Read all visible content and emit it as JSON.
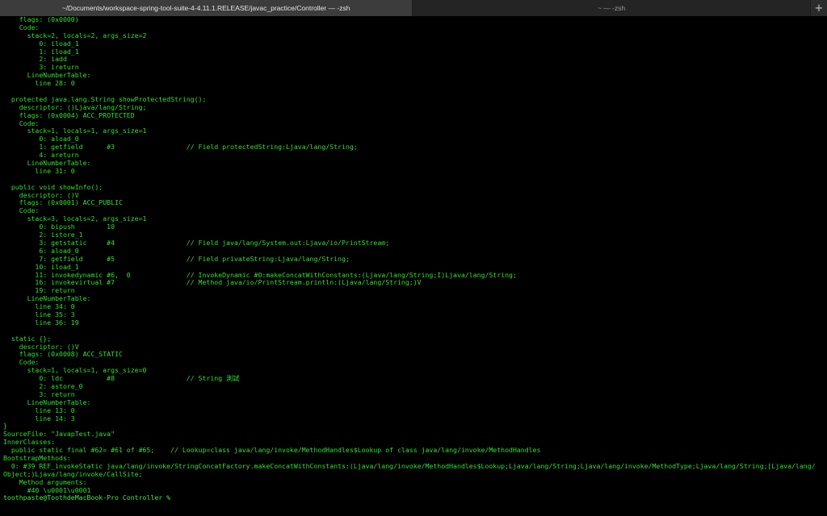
{
  "window": {
    "tabs": [
      {
        "label": "~/Documents/workspace-spring-tool-suite-4-4.11.1.RELEASE/javac_practice/Controller — -zsh",
        "active": true
      },
      {
        "label": "~ — -zsh",
        "active": false
      }
    ],
    "new_tab_icon": "plus-icon"
  },
  "terminal": {
    "text_color": "#2fe02f",
    "background": "#000000",
    "lines": [
      "    flags: (0x0000)",
      "    Code:",
      "      stack=2, locals=2, args_size=2",
      "         0: iload_1",
      "         1: iload_1",
      "         2: iadd",
      "         3: ireturn",
      "      LineNumberTable:",
      "        line 28: 0",
      "",
      "  protected java.lang.String showProtectedString();",
      "    descriptor: ()Ljava/lang/String;",
      "    flags: (0x0004) ACC_PROTECTED",
      "    Code:",
      "      stack=1, locals=1, args_size=1",
      "         0: aload_0",
      "         1: getfield      #3                  // Field protectedString:Ljava/lang/String;",
      "         4: areturn",
      "      LineNumberTable:",
      "        line 31: 0",
      "",
      "  public void showInfo();",
      "    descriptor: ()V",
      "    flags: (0x0001) ACC_PUBLIC",
      "    Code:",
      "      stack=3, locals=2, args_size=1",
      "         0: bipush        10",
      "         2: istore_1",
      "         3: getstatic     #4                  // Field java/lang/System.out:Ljava/io/PrintStream;",
      "         6: aload_0",
      "         7: getfield      #5                  // Field privateString:Ljava/lang/String;",
      "        10: iload_1",
      "        11: invokedynamic #6,  0              // InvokeDynamic #0:makeConcatWithConstants:(Ljava/lang/String;I)Ljava/lang/String;",
      "        16: invokevirtual #7                  // Method java/io/PrintStream.println:(Ljava/lang/String;)V",
      "        19: return",
      "      LineNumberTable:",
      "        line 34: 0",
      "        line 35: 3",
      "        line 36: 19",
      "",
      "  static {};",
      "    descriptor: ()V",
      "    flags: (0x0008) ACC_STATIC",
      "    Code:",
      "      stack=1, locals=1, args_size=0",
      "         0: ldc           #8                  // String 測試",
      "         2: astore_0",
      "         3: return",
      "      LineNumberTable:",
      "        line 13: 0",
      "        line 14: 3",
      "}",
      "SourceFile: \"JavapTest.java\"",
      "InnerClasses:",
      "  public static final #62= #61 of #65;    // Lookup=class java/lang/invoke/MethodHandles$Lookup of class java/lang/invoke/MethodHandles",
      "BootstrapMethods:",
      "  0: #39 REF_invokeStatic java/lang/invoke/StringConcatFactory.makeConcatWithConstants:(Ljava/lang/invoke/MethodHandles$Lookup;Ljava/lang/String;Ljava/lang/invoke/MethodType;Ljava/lang/String;[Ljava/lang/",
      "Object;)Ljava/lang/invoke/CallSite;",
      "    Method arguments:",
      "      #40 \\u0001\\u0001"
    ],
    "prompt": "toothpaste@ToothdeMacBook-Pro Controller % "
  }
}
